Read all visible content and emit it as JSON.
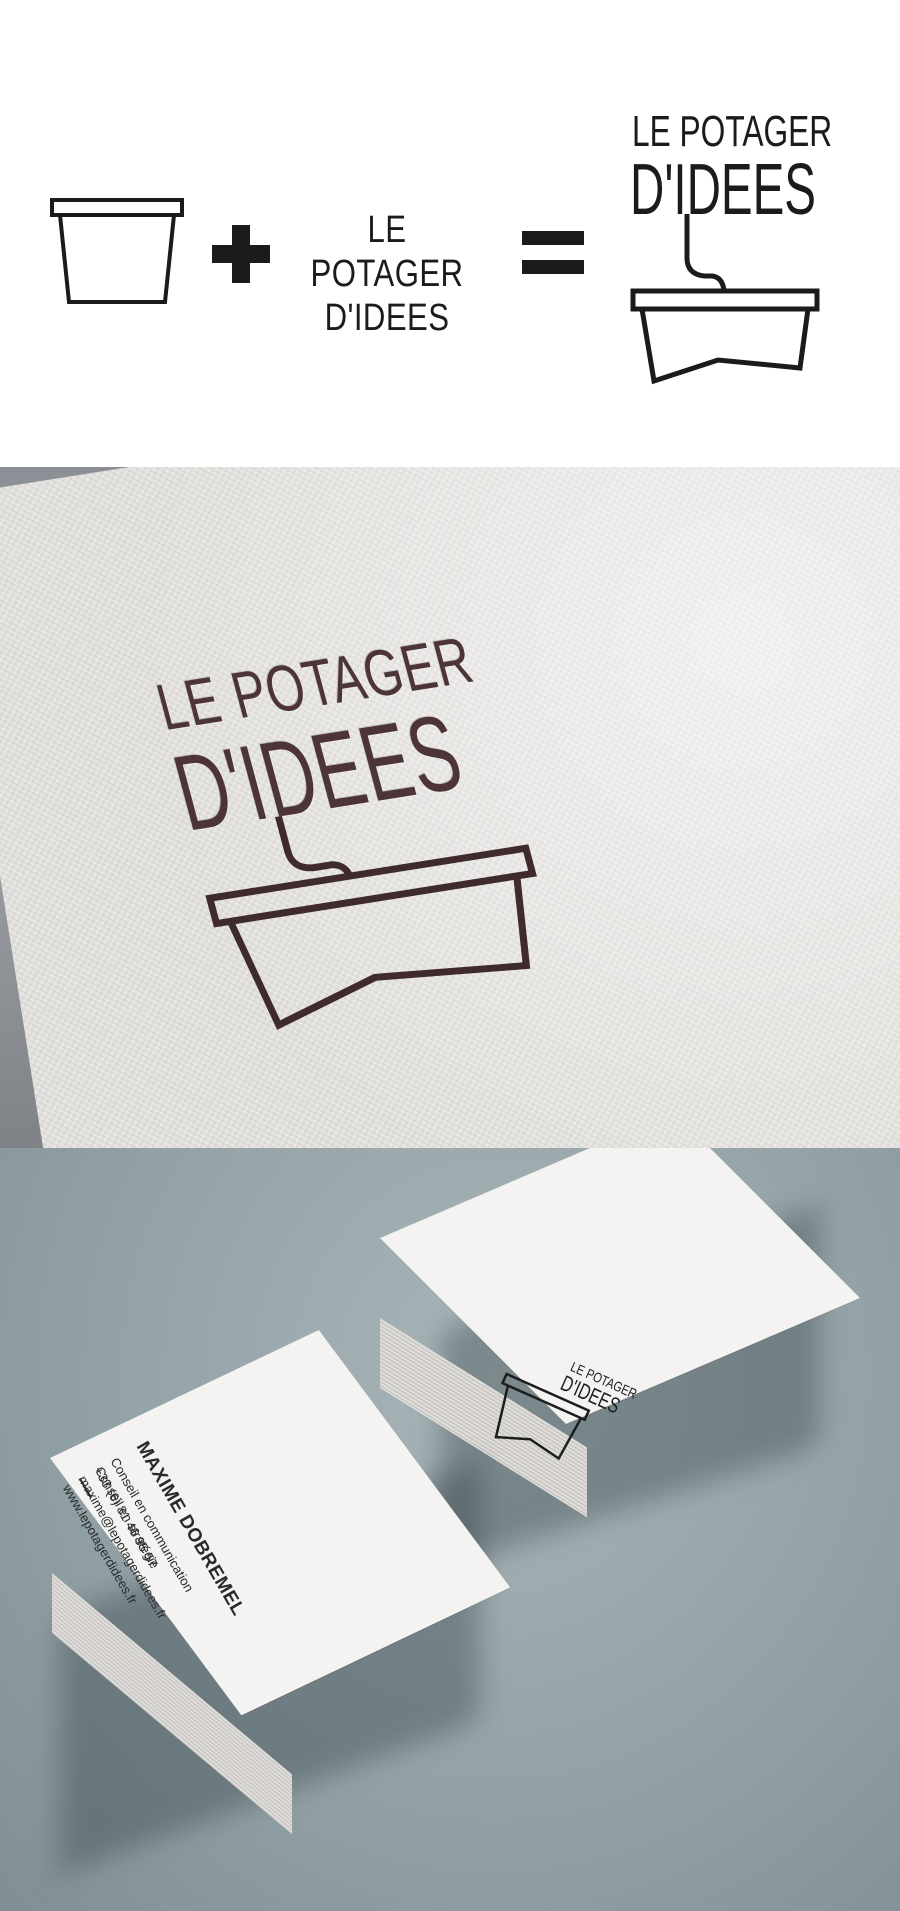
{
  "logo": {
    "line1": "LE POTAGER",
    "line2": "D'IDEES"
  },
  "equation": {
    "plus_icon": "plus-icon",
    "equals_icon": "equals-icon",
    "pot_icon": "flower-pot-icon"
  },
  "card": {
    "name": "MAXIME DOBREMEL",
    "role1": "Conseil en communication",
    "role2": "Conseil en stratégie",
    "phone": "+33 (6) 81 46 95 57",
    "email": "maxime@lepotagerdidees.fr",
    "website": "www.lepotagerdidees.fr"
  },
  "colors": {
    "ink": "#1b1b1b",
    "emboss": "#4d3438",
    "paper": "#e7e5e2",
    "backdrop": "#93a2a6"
  }
}
